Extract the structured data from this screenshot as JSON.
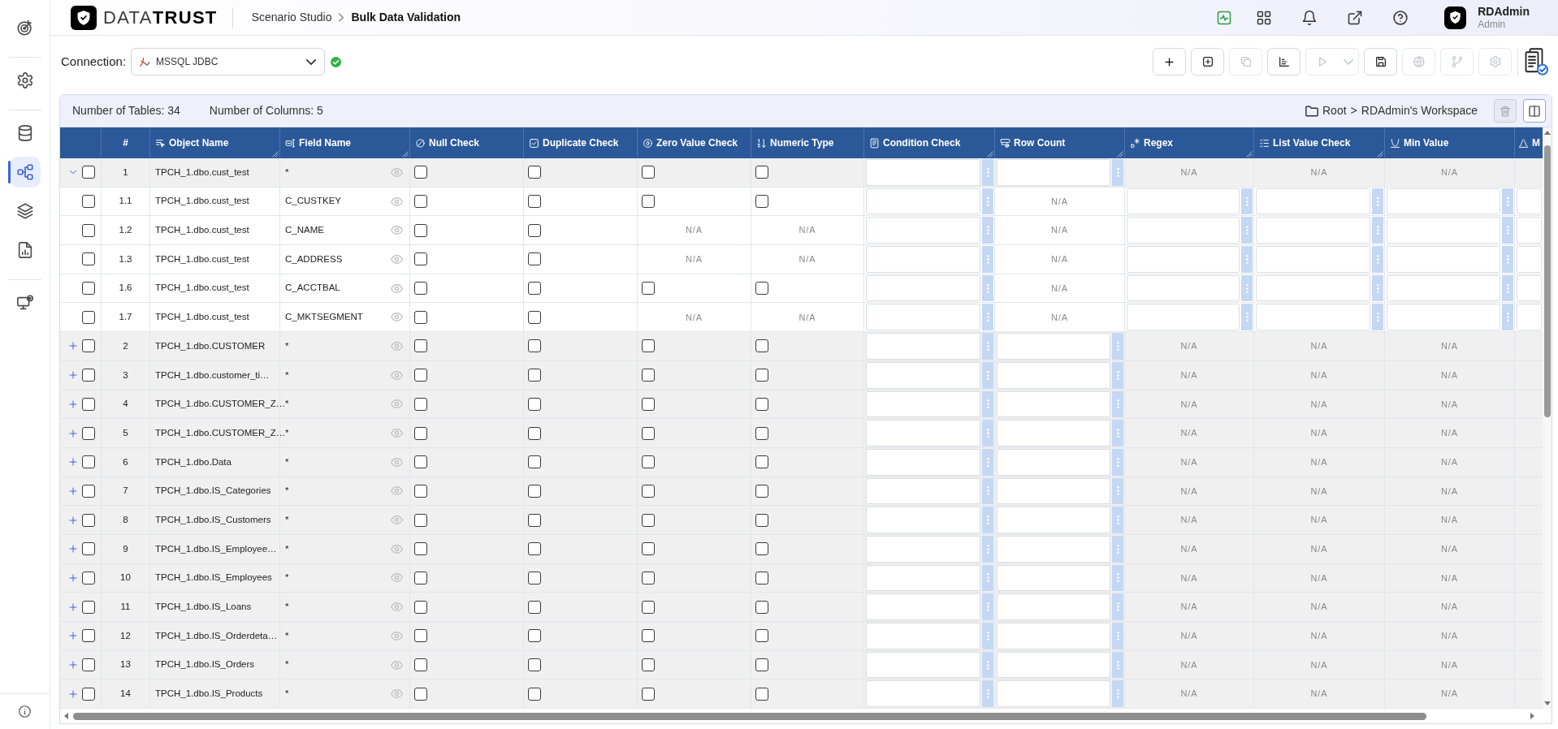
{
  "sidebar": {
    "groups": [
      {
        "items": [
          {
            "selected": false
          }
        ]
      },
      {
        "items": [
          {
            "selected": false
          }
        ]
      },
      {
        "items": [
          {
            "selected": false
          },
          {
            "selected": true
          },
          {
            "selected": false
          },
          {
            "selected": false
          }
        ]
      },
      {
        "items": [
          {
            "selected": false
          }
        ]
      }
    ]
  },
  "header": {
    "logo_text": "DATA**TRUST**",
    "breadcrumb": [
      {
        "label": "Scenario Studio",
        "current": false
      },
      {
        "label": "Bulk Data Validation",
        "current": true
      }
    ],
    "user": {
      "name": "RDAdmin",
      "role": "Admin"
    }
  },
  "toolbar": {
    "connection_label": "Connection:",
    "connection": {
      "value": "MSSQL JDBC",
      "connected": true
    },
    "buttons": [
      {
        "disabled": false
      },
      {
        "disabled": false
      },
      {
        "disabled": true
      },
      {
        "disabled": false
      },
      {
        "disabled": true
      },
      {
        "disabled": false
      },
      {
        "disabled": true
      },
      {
        "disabled": true
      },
      {
        "disabled": true
      }
    ]
  },
  "summary": {
    "stats": [
      "Number of Tables: 34",
      "Number of Columns: 5"
    ],
    "location": {
      "path": [
        "Root",
        "RDAdmin's Workspace"
      ],
      "separator": ">"
    },
    "buttons": [
      {
        "disabled": true
      },
      {
        "disabled": false
      }
    ]
  },
  "table": {
    "columns": [
      {
        "label": "#",
        "resizable": false
      },
      {
        "label": "Object Name",
        "resizable": true
      },
      {
        "label": "Field Name",
        "resizable": true
      },
      {
        "label": "Null Check",
        "resizable": false
      },
      {
        "label": "Duplicate Check",
        "resizable": false
      },
      {
        "label": "Zero Value Check",
        "resizable": false
      },
      {
        "label": "Numeric Type",
        "resizable": false
      },
      {
        "label": "Condition Check",
        "resizable": true
      },
      {
        "label": "Row Count",
        "resizable": true
      },
      {
        "label": "Regex",
        "resizable": true
      },
      {
        "label": "List Value Check",
        "resizable": true
      },
      {
        "label": "Min Value",
        "resizable": false
      },
      {
        "label": "M",
        "resizable": false
      }
    ],
    "rows": [
      {
        "number": "1",
        "object_name": "TPCH_1.dbo.cust_test",
        "field_name": "*",
        "checked": false,
        "expanded": true,
        "cells": [
          {
            "kind": "checkbox",
            "checked": false
          },
          {
            "kind": "checkbox",
            "checked": false
          },
          {
            "kind": "checkbox",
            "checked": false
          },
          {
            "kind": "checkbox",
            "checked": false
          },
          {
            "kind": "input"
          },
          {
            "kind": "input"
          },
          {
            "kind": "na",
            "text": "N/A"
          },
          {
            "kind": "na",
            "text": "N/A"
          },
          {
            "kind": "na",
            "text": "N/A"
          }
        ],
        "children": [
          {
            "number": "1.1",
            "object_name": "TPCH_1.dbo.cust_test",
            "field_name": "C_CUSTKEY",
            "checked": false,
            "cells": [
              {
                "kind": "checkbox",
                "checked": false
              },
              {
                "kind": "checkbox",
                "checked": false
              },
              {
                "kind": "checkbox",
                "checked": false
              },
              {
                "kind": "checkbox",
                "checked": false
              },
              {
                "kind": "input"
              },
              {
                "kind": "na",
                "text": "N/A"
              },
              {
                "kind": "input"
              },
              {
                "kind": "input"
              },
              {
                "kind": "input"
              },
              {
                "kind": "input"
              }
            ]
          },
          {
            "number": "1.2",
            "object_name": "TPCH_1.dbo.cust_test",
            "field_name": "C_NAME",
            "checked": false,
            "cells": [
              {
                "kind": "checkbox",
                "checked": false
              },
              {
                "kind": "checkbox",
                "checked": false
              },
              {
                "kind": "na",
                "text": "N/A"
              },
              {
                "kind": "na",
                "text": "N/A"
              },
              {
                "kind": "input"
              },
              {
                "kind": "na",
                "text": "N/A"
              },
              {
                "kind": "input"
              },
              {
                "kind": "input"
              },
              {
                "kind": "input"
              },
              {
                "kind": "input"
              }
            ]
          },
          {
            "number": "1.3",
            "object_name": "TPCH_1.dbo.cust_test",
            "field_name": "C_ADDRESS",
            "checked": false,
            "cells": [
              {
                "kind": "checkbox",
                "checked": false
              },
              {
                "kind": "checkbox",
                "checked": false
              },
              {
                "kind": "na",
                "text": "N/A"
              },
              {
                "kind": "na",
                "text": "N/A"
              },
              {
                "kind": "input"
              },
              {
                "kind": "na",
                "text": "N/A"
              },
              {
                "kind": "input"
              },
              {
                "kind": "input"
              },
              {
                "kind": "input"
              },
              {
                "kind": "input"
              }
            ]
          },
          {
            "number": "1.6",
            "object_name": "TPCH_1.dbo.cust_test",
            "field_name": "C_ACCTBAL",
            "checked": false,
            "cells": [
              {
                "kind": "checkbox",
                "checked": false
              },
              {
                "kind": "checkbox",
                "checked": false
              },
              {
                "kind": "checkbox",
                "checked": false
              },
              {
                "kind": "checkbox",
                "checked": false
              },
              {
                "kind": "input"
              },
              {
                "kind": "na",
                "text": "N/A"
              },
              {
                "kind": "input"
              },
              {
                "kind": "input"
              },
              {
                "kind": "input"
              },
              {
                "kind": "input"
              }
            ]
          },
          {
            "number": "1.7",
            "object_name": "TPCH_1.dbo.cust_test",
            "field_name": "C_MKTSEGMENT",
            "checked": false,
            "cells": [
              {
                "kind": "checkbox",
                "checked": false
              },
              {
                "kind": "checkbox",
                "checked": false
              },
              {
                "kind": "na",
                "text": "N/A"
              },
              {
                "kind": "na",
                "text": "N/A"
              },
              {
                "kind": "input"
              },
              {
                "kind": "na",
                "text": "N/A"
              },
              {
                "kind": "input"
              },
              {
                "kind": "input"
              },
              {
                "kind": "input"
              },
              {
                "kind": "input"
              }
            ]
          }
        ]
      },
      {
        "number": "2",
        "object_name": "TPCH_1.dbo.CUSTOMER",
        "field_name": "*",
        "checked": false,
        "expanded": false,
        "cells": [
          {
            "kind": "checkbox",
            "checked": false
          },
          {
            "kind": "checkbox",
            "checked": false
          },
          {
            "kind": "checkbox",
            "checked": false
          },
          {
            "kind": "checkbox",
            "checked": false
          },
          {
            "kind": "input"
          },
          {
            "kind": "input"
          },
          {
            "kind": "na",
            "text": "N/A"
          },
          {
            "kind": "na",
            "text": "N/A"
          },
          {
            "kind": "na",
            "text": "N/A"
          }
        ]
      },
      {
        "number": "3",
        "object_name": "TPCH_1.dbo.customer_ti…",
        "field_name": "*",
        "checked": false,
        "expanded": false,
        "cells": [
          {
            "kind": "checkbox",
            "checked": false
          },
          {
            "kind": "checkbox",
            "checked": false
          },
          {
            "kind": "checkbox",
            "checked": false
          },
          {
            "kind": "checkbox",
            "checked": false
          },
          {
            "kind": "input"
          },
          {
            "kind": "input"
          },
          {
            "kind": "na",
            "text": "N/A"
          },
          {
            "kind": "na",
            "text": "N/A"
          },
          {
            "kind": "na",
            "text": "N/A"
          }
        ]
      },
      {
        "number": "4",
        "object_name": "TPCH_1.dbo.CUSTOMER_Z…",
        "field_name": "*",
        "checked": false,
        "expanded": false,
        "cells": [
          {
            "kind": "checkbox",
            "checked": false
          },
          {
            "kind": "checkbox",
            "checked": false
          },
          {
            "kind": "checkbox",
            "checked": false
          },
          {
            "kind": "checkbox",
            "checked": false
          },
          {
            "kind": "input"
          },
          {
            "kind": "input"
          },
          {
            "kind": "na",
            "text": "N/A"
          },
          {
            "kind": "na",
            "text": "N/A"
          },
          {
            "kind": "na",
            "text": "N/A"
          }
        ]
      },
      {
        "number": "5",
        "object_name": "TPCH_1.dbo.CUSTOMER_Z…",
        "field_name": "*",
        "checked": false,
        "expanded": false,
        "cells": [
          {
            "kind": "checkbox",
            "checked": false
          },
          {
            "kind": "checkbox",
            "checked": false
          },
          {
            "kind": "checkbox",
            "checked": false
          },
          {
            "kind": "checkbox",
            "checked": false
          },
          {
            "kind": "input"
          },
          {
            "kind": "input"
          },
          {
            "kind": "na",
            "text": "N/A"
          },
          {
            "kind": "na",
            "text": "N/A"
          },
          {
            "kind": "na",
            "text": "N/A"
          }
        ]
      },
      {
        "number": "6",
        "object_name": "TPCH_1.dbo.Data",
        "field_name": "*",
        "checked": false,
        "expanded": false,
        "cells": [
          {
            "kind": "checkbox",
            "checked": false
          },
          {
            "kind": "checkbox",
            "checked": false
          },
          {
            "kind": "checkbox",
            "checked": false
          },
          {
            "kind": "checkbox",
            "checked": false
          },
          {
            "kind": "input"
          },
          {
            "kind": "input"
          },
          {
            "kind": "na",
            "text": "N/A"
          },
          {
            "kind": "na",
            "text": "N/A"
          },
          {
            "kind": "na",
            "text": "N/A"
          }
        ]
      },
      {
        "number": "7",
        "object_name": "TPCH_1.dbo.IS_Categories",
        "field_name": "*",
        "checked": false,
        "expanded": false,
        "cells": [
          {
            "kind": "checkbox",
            "checked": false
          },
          {
            "kind": "checkbox",
            "checked": false
          },
          {
            "kind": "checkbox",
            "checked": false
          },
          {
            "kind": "checkbox",
            "checked": false
          },
          {
            "kind": "input"
          },
          {
            "kind": "input"
          },
          {
            "kind": "na",
            "text": "N/A"
          },
          {
            "kind": "na",
            "text": "N/A"
          },
          {
            "kind": "na",
            "text": "N/A"
          }
        ]
      },
      {
        "number": "8",
        "object_name": "TPCH_1.dbo.IS_Customers",
        "field_name": "*",
        "checked": false,
        "expanded": false,
        "cells": [
          {
            "kind": "checkbox",
            "checked": false
          },
          {
            "kind": "checkbox",
            "checked": false
          },
          {
            "kind": "checkbox",
            "checked": false
          },
          {
            "kind": "checkbox",
            "checked": false
          },
          {
            "kind": "input"
          },
          {
            "kind": "input"
          },
          {
            "kind": "na",
            "text": "N/A"
          },
          {
            "kind": "na",
            "text": "N/A"
          },
          {
            "kind": "na",
            "text": "N/A"
          }
        ]
      },
      {
        "number": "9",
        "object_name": "TPCH_1.dbo.IS_Employee…",
        "field_name": "*",
        "checked": false,
        "expanded": false,
        "cells": [
          {
            "kind": "checkbox",
            "checked": false
          },
          {
            "kind": "checkbox",
            "checked": false
          },
          {
            "kind": "checkbox",
            "checked": false
          },
          {
            "kind": "checkbox",
            "checked": false
          },
          {
            "kind": "input"
          },
          {
            "kind": "input"
          },
          {
            "kind": "na",
            "text": "N/A"
          },
          {
            "kind": "na",
            "text": "N/A"
          },
          {
            "kind": "na",
            "text": "N/A"
          }
        ]
      },
      {
        "number": "10",
        "object_name": "TPCH_1.dbo.IS_Employees",
        "field_name": "*",
        "checked": false,
        "expanded": false,
        "cells": [
          {
            "kind": "checkbox",
            "checked": false
          },
          {
            "kind": "checkbox",
            "checked": false
          },
          {
            "kind": "checkbox",
            "checked": false
          },
          {
            "kind": "checkbox",
            "checked": false
          },
          {
            "kind": "input"
          },
          {
            "kind": "input"
          },
          {
            "kind": "na",
            "text": "N/A"
          },
          {
            "kind": "na",
            "text": "N/A"
          },
          {
            "kind": "na",
            "text": "N/A"
          }
        ]
      },
      {
        "number": "11",
        "object_name": "TPCH_1.dbo.IS_Loans",
        "field_name": "*",
        "checked": false,
        "expanded": false,
        "cells": [
          {
            "kind": "checkbox",
            "checked": false
          },
          {
            "kind": "checkbox",
            "checked": false
          },
          {
            "kind": "checkbox",
            "checked": false
          },
          {
            "kind": "checkbox",
            "checked": false
          },
          {
            "kind": "input"
          },
          {
            "kind": "input"
          },
          {
            "kind": "na",
            "text": "N/A"
          },
          {
            "kind": "na",
            "text": "N/A"
          },
          {
            "kind": "na",
            "text": "N/A"
          }
        ]
      },
      {
        "number": "12",
        "object_name": "TPCH_1.dbo.IS_Orderdeta…",
        "field_name": "*",
        "checked": false,
        "expanded": false,
        "cells": [
          {
            "kind": "checkbox",
            "checked": false
          },
          {
            "kind": "checkbox",
            "checked": false
          },
          {
            "kind": "checkbox",
            "checked": false
          },
          {
            "kind": "checkbox",
            "checked": false
          },
          {
            "kind": "input"
          },
          {
            "kind": "input"
          },
          {
            "kind": "na",
            "text": "N/A"
          },
          {
            "kind": "na",
            "text": "N/A"
          },
          {
            "kind": "na",
            "text": "N/A"
          }
        ]
      },
      {
        "number": "13",
        "object_name": "TPCH_1.dbo.IS_Orders",
        "field_name": "*",
        "checked": false,
        "expanded": false,
        "cells": [
          {
            "kind": "checkbox",
            "checked": false
          },
          {
            "kind": "checkbox",
            "checked": false
          },
          {
            "kind": "checkbox",
            "checked": false
          },
          {
            "kind": "checkbox",
            "checked": false
          },
          {
            "kind": "input"
          },
          {
            "kind": "input"
          },
          {
            "kind": "na",
            "text": "N/A"
          },
          {
            "kind": "na",
            "text": "N/A"
          },
          {
            "kind": "na",
            "text": "N/A"
          }
        ]
      },
      {
        "number": "14",
        "object_name": "TPCH_1.dbo.IS_Products",
        "field_name": "*",
        "checked": false,
        "expanded": false,
        "cells": [
          {
            "kind": "checkbox",
            "checked": false
          },
          {
            "kind": "checkbox",
            "checked": false
          },
          {
            "kind": "checkbox",
            "checked": false
          },
          {
            "kind": "checkbox",
            "checked": false
          },
          {
            "kind": "input"
          },
          {
            "kind": "input"
          },
          {
            "kind": "na",
            "text": "N/A"
          },
          {
            "kind": "na",
            "text": "N/A"
          },
          {
            "kind": "na",
            "text": "N/A"
          }
        ]
      }
    ]
  }
}
